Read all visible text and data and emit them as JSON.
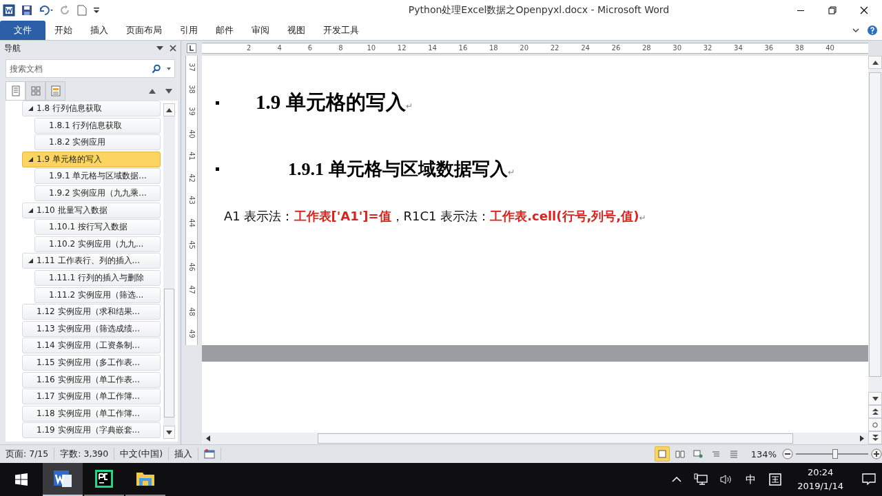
{
  "window": {
    "title": "Python处理Excel数据之Openpyxl.docx - Microsoft Word"
  },
  "ribbon_tabs": [
    {
      "label": "文件",
      "kind": "file",
      "selected": false
    },
    {
      "label": "开始",
      "kind": "tab",
      "selected": false
    },
    {
      "label": "插入",
      "kind": "tab",
      "selected": false
    },
    {
      "label": "页面布局",
      "kind": "tab",
      "selected": false
    },
    {
      "label": "引用",
      "kind": "tab",
      "selected": false
    },
    {
      "label": "邮件",
      "kind": "tab",
      "selected": false
    },
    {
      "label": "审阅",
      "kind": "tab",
      "selected": false
    },
    {
      "label": "视图",
      "kind": "tab",
      "selected": false
    },
    {
      "label": "开发工具",
      "kind": "tab",
      "selected": false
    }
  ],
  "navigation": {
    "title": "导航",
    "search": {
      "placeholder": "搜索文档"
    },
    "view_tabs": [
      {
        "kind": "headings",
        "selected": true
      },
      {
        "kind": "pages",
        "selected": false
      },
      {
        "kind": "results",
        "selected": false
      }
    ],
    "items": [
      {
        "label": "1.8 行列信息获取",
        "selected": false,
        "expanded": true,
        "children": [
          {
            "label": "1.8.1 行列信息获取",
            "selected": false
          },
          {
            "label": "1.8.2 实例应用",
            "selected": false
          }
        ]
      },
      {
        "label": "1.9 单元格的写入",
        "selected": true,
        "expanded": true,
        "children": [
          {
            "label": "1.9.1 单元格与区域数据...",
            "selected": false
          },
          {
            "label": "1.9.2 实例应用（九九乘...",
            "selected": false
          }
        ]
      },
      {
        "label": "1.10 批量写入数据",
        "selected": false,
        "expanded": true,
        "children": [
          {
            "label": "1.10.1 按行写入数据",
            "selected": false
          },
          {
            "label": "1.10.2 实例应用（九九...",
            "selected": false
          }
        ]
      },
      {
        "label": "1.11 工作表行、列的插入...",
        "selected": false,
        "expanded": true,
        "children": [
          {
            "label": "1.11.1 行列的插入与删除",
            "selected": false
          },
          {
            "label": "1.11.2 实例应用（筛选...",
            "selected": false
          }
        ]
      },
      {
        "label": "1.12 实例应用（求和结果...",
        "selected": false,
        "expanded": false
      },
      {
        "label": "1.13 实例应用（筛选成绩...",
        "selected": false,
        "expanded": false
      },
      {
        "label": "1.14 实例应用（工资条制...",
        "selected": false,
        "expanded": false
      },
      {
        "label": "1.15 实例应用（多工作表...",
        "selected": false,
        "expanded": false
      },
      {
        "label": "1.16 实例应用（单工作表...",
        "selected": false,
        "expanded": false
      },
      {
        "label": "1.17 实例应用（单工作簿...",
        "selected": false,
        "expanded": false
      },
      {
        "label": "1.18 实例应用（单工作簿...",
        "selected": false,
        "expanded": false
      },
      {
        "label": "1.19 实例应用（字典嵌套...",
        "selected": false,
        "expanded": false
      }
    ]
  },
  "ruler": {
    "horizontal": [
      "2",
      "4",
      "6",
      "8",
      "10",
      "12",
      "14",
      "16",
      "18",
      "20",
      "22",
      "24",
      "26",
      "28",
      "30",
      "32",
      "34",
      "36",
      "38",
      "40"
    ],
    "vertical": [
      "37",
      "38",
      "39",
      "40",
      "41",
      "42",
      "43",
      "44",
      "45",
      "46",
      "47",
      "48",
      "49"
    ]
  },
  "document": {
    "heading1": "1.9 单元格的写入",
    "heading2": "1.9.1 单元格与区域数据写入",
    "para_mark": "↵",
    "paragraph": [
      {
        "kind": "plain",
        "text": "A1 表示法："
      },
      {
        "kind": "code",
        "text": "工作表['A1']=值"
      },
      {
        "kind": "plain",
        "text": "，R1C1 表示法："
      },
      {
        "kind": "code",
        "text": "工作表.cell(行号,列号,值)"
      }
    ]
  },
  "status_bar": {
    "page": "页面: 7/15",
    "words": "字数: 3,390",
    "language": "中文(中国)",
    "mode": "插入",
    "views": [
      {
        "kind": "print",
        "selected": true
      },
      {
        "kind": "reading",
        "selected": false
      },
      {
        "kind": "web",
        "selected": false
      },
      {
        "kind": "outline",
        "selected": false
      },
      {
        "kind": "draft",
        "selected": false
      }
    ],
    "zoom": "134%",
    "zoom_slider": {
      "level": 0.54
    }
  },
  "taskbar": {
    "apps": [
      {
        "kind": "word",
        "selected": true
      },
      {
        "kind": "pycharm",
        "selected": false
      },
      {
        "kind": "explorer",
        "selected": false
      }
    ],
    "ime": "中",
    "time": "20:24",
    "date": "2019/1/14"
  }
}
